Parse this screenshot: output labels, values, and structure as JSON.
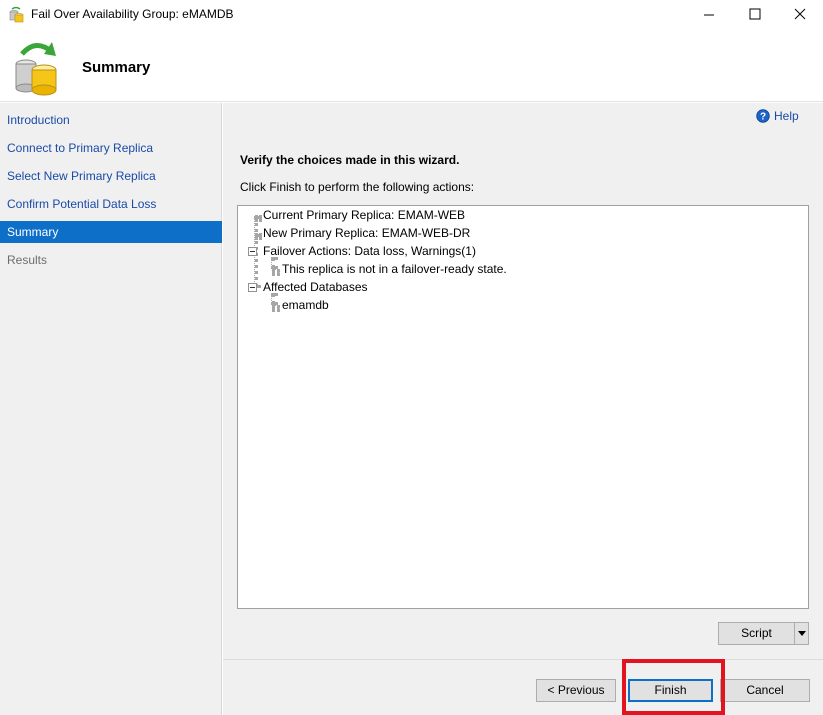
{
  "window": {
    "title": "Fail Over Availability Group: eMAMDB",
    "icons": {
      "app": "database-sync-icon",
      "minimize": "minimize-icon",
      "maximize": "maximize-icon",
      "close": "close-icon"
    }
  },
  "header": {
    "title": "Summary",
    "icon": "database-sync-icon"
  },
  "sidebar": {
    "items": [
      {
        "label": "Introduction",
        "state": "link"
      },
      {
        "label": "Connect to Primary Replica",
        "state": "link"
      },
      {
        "label": "Select New Primary Replica",
        "state": "link"
      },
      {
        "label": "Confirm Potential Data Loss",
        "state": "link"
      },
      {
        "label": "Summary",
        "state": "active"
      },
      {
        "label": "Results",
        "state": "disabled"
      }
    ]
  },
  "main": {
    "help_label": "Help",
    "heading": "Verify the choices made in this wizard.",
    "instructions": "Click Finish to perform the following actions:",
    "tree": [
      {
        "label": "Current Primary Replica: EMAM-WEB",
        "level": 0,
        "expandable": false
      },
      {
        "label": "New Primary Replica: EMAM-WEB-DR",
        "level": 0,
        "expandable": false
      },
      {
        "label": "Failover Actions: Data loss, Warnings(1)",
        "level": 0,
        "expandable": true
      },
      {
        "label": "This replica is not in a failover-ready state.",
        "level": 1,
        "expandable": false
      },
      {
        "label": "Affected Databases",
        "level": 0,
        "expandable": true
      },
      {
        "label": "emamdb",
        "level": 1,
        "expandable": false
      }
    ]
  },
  "buttons": {
    "script": "Script",
    "previous": "< Previous",
    "finish": "Finish",
    "cancel": "Cancel"
  },
  "colors": {
    "accent": "#0e6fc9",
    "link": "#1a4aa8",
    "highlight": "#e1141f"
  }
}
